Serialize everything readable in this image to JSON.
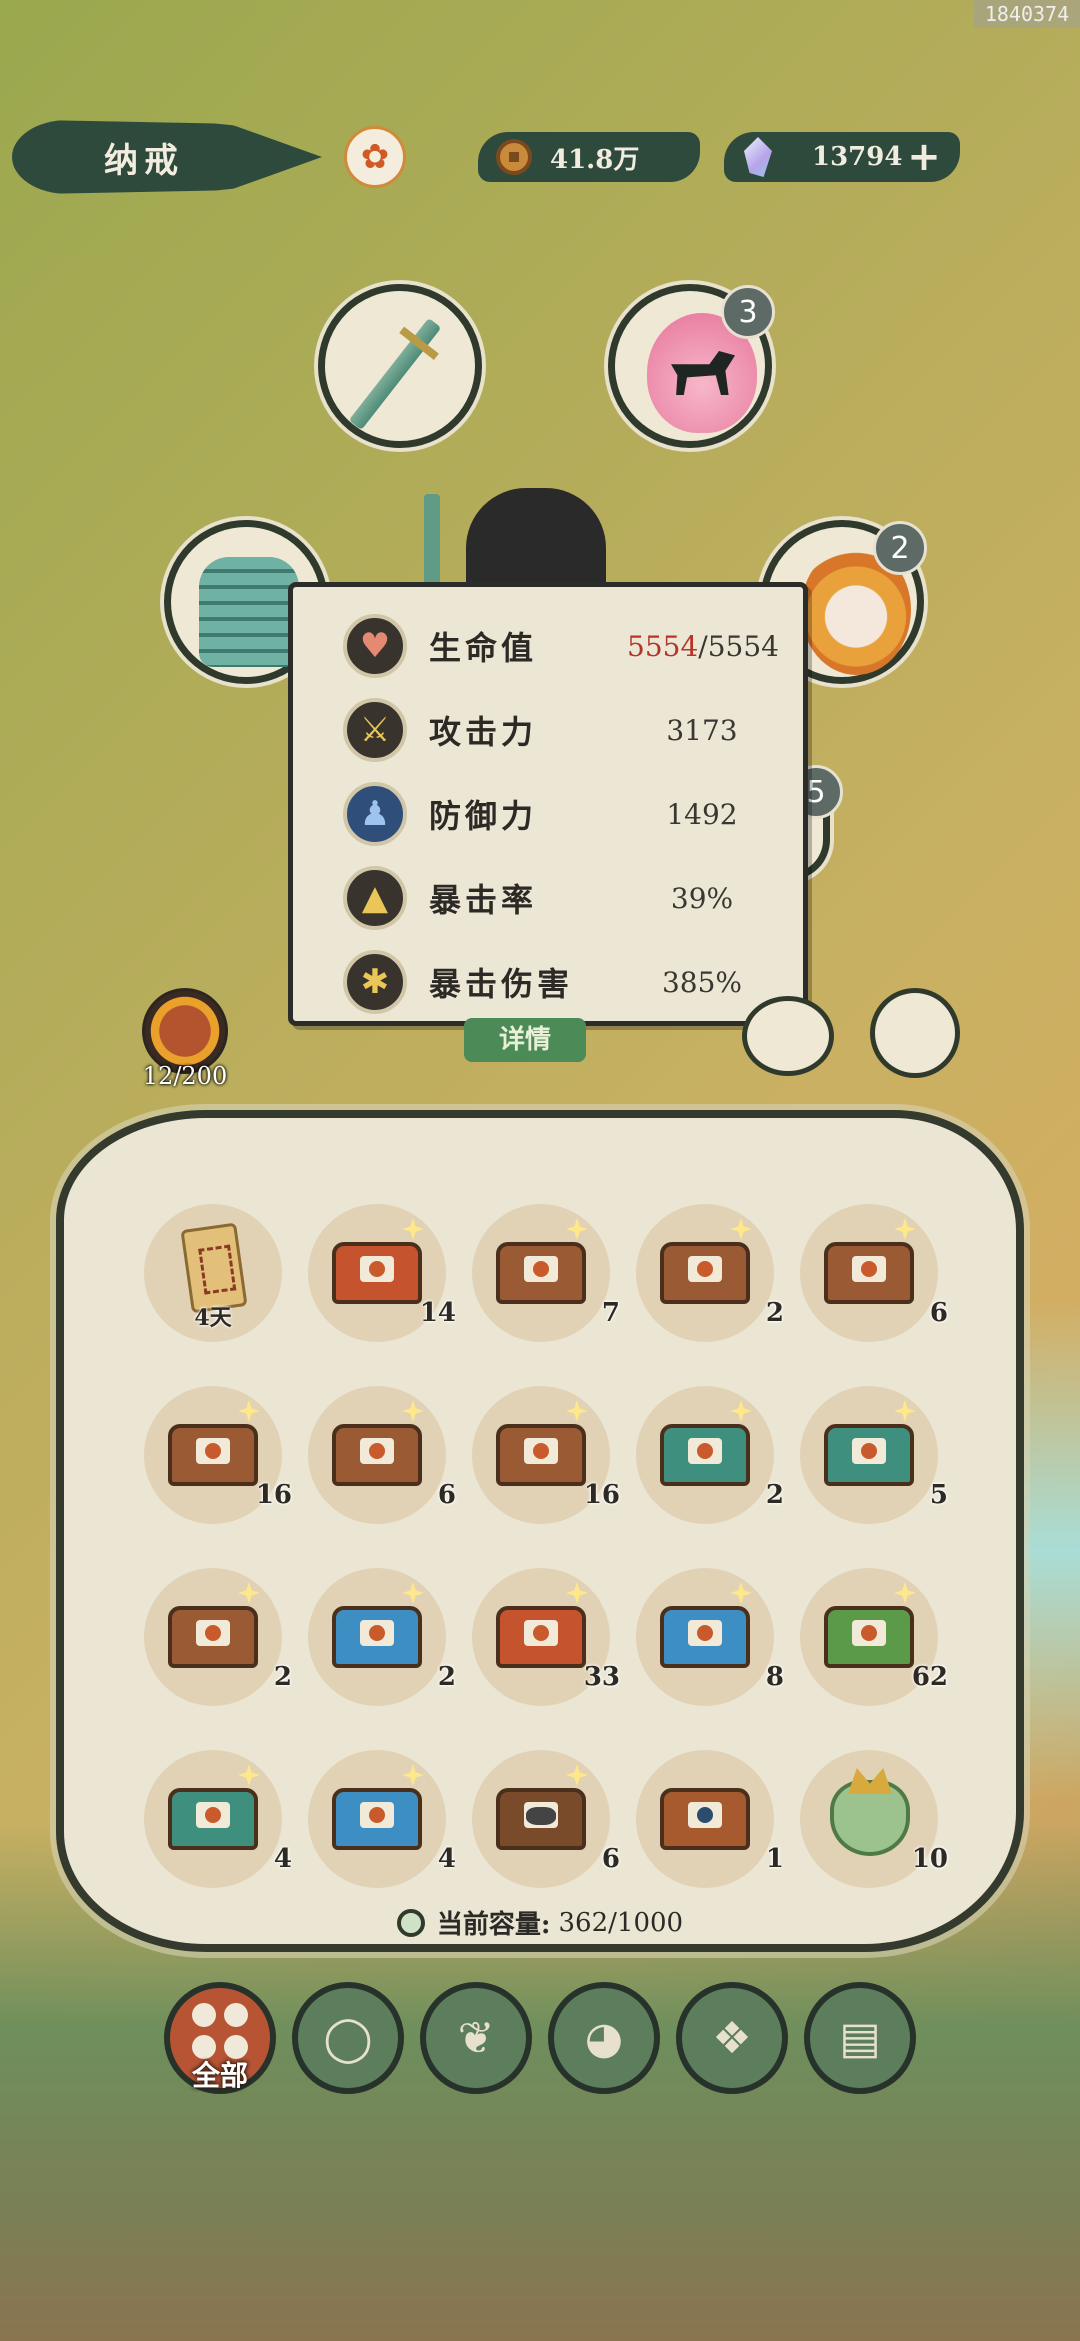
{
  "watermark": "1840374",
  "header": {
    "title": "纳戒",
    "coins": "41.8万",
    "gems": "13794",
    "plus_icon": "plus-icon"
  },
  "equipment": {
    "pet_badge": "3",
    "hero_badge": "2",
    "partial_badge": "5"
  },
  "stats": [
    {
      "label": "生命值",
      "value_current": "5554",
      "value_rest": "/5554",
      "icon": "heart-icon"
    },
    {
      "label": "攻击力",
      "value": "3173",
      "icon": "sword-icon"
    },
    {
      "label": "防御力",
      "value": "1492",
      "icon": "person-icon"
    },
    {
      "label": "暴击率",
      "value": "39%",
      "icon": "crit-icon"
    },
    {
      "label": "暴击伤害",
      "value": "385%",
      "icon": "crit-damage-icon"
    }
  ],
  "details_button": "详情",
  "boss_counter": "12/200",
  "items": [
    {
      "kind": "scroll",
      "count": "4天"
    },
    {
      "kind": "red",
      "count": "14"
    },
    {
      "kind": "wood",
      "count": "7"
    },
    {
      "kind": "wood",
      "count": "2"
    },
    {
      "kind": "wood",
      "count": "6"
    },
    {
      "kind": "wood",
      "count": "16"
    },
    {
      "kind": "wood",
      "count": "6"
    },
    {
      "kind": "wood",
      "count": "16"
    },
    {
      "kind": "teal",
      "count": "2"
    },
    {
      "kind": "teal",
      "count": "5"
    },
    {
      "kind": "wood",
      "count": "2"
    },
    {
      "kind": "blue",
      "count": "2"
    },
    {
      "kind": "red",
      "count": "33"
    },
    {
      "kind": "blue",
      "count": "8"
    },
    {
      "kind": "green",
      "count": "62"
    },
    {
      "kind": "teal",
      "count": "4"
    },
    {
      "kind": "blue",
      "count": "4"
    },
    {
      "kind": "coal",
      "count": "6"
    },
    {
      "kind": "open",
      "count": "1"
    },
    {
      "kind": "pouch",
      "count": "10"
    }
  ],
  "capacity": {
    "label": "当前容量:",
    "value": "362/1000"
  },
  "tabs": [
    {
      "name": "tab-all",
      "label": "全部",
      "icon": "grid-icon",
      "active": true
    },
    {
      "name": "tab-wood",
      "icon": "log-icon"
    },
    {
      "name": "tab-herb",
      "icon": "herb-icon"
    },
    {
      "name": "tab-food",
      "icon": "rice-bowl-icon"
    },
    {
      "name": "tab-ore",
      "icon": "ore-icon"
    },
    {
      "name": "tab-scroll",
      "icon": "scroll-icon"
    }
  ],
  "colors": {
    "accent_red": "#b5352a",
    "panel": "#ece6d4",
    "dark_green": "#2e4a3c"
  }
}
